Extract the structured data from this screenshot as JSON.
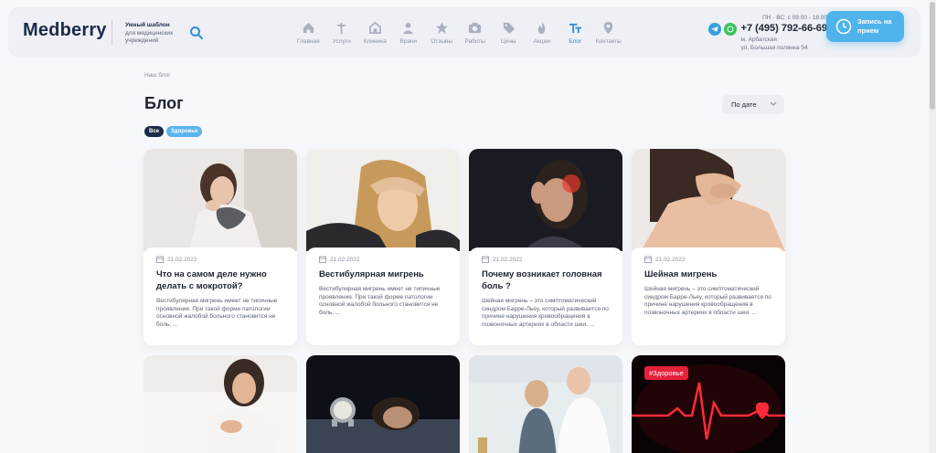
{
  "header": {
    "logo": "Medberry",
    "tagline_bold": "Умный шаблон",
    "tagline": "для медицинских учреждений",
    "nav": [
      {
        "label": "Главная",
        "icon": "home-icon"
      },
      {
        "label": "Услуги",
        "icon": "caduceus-icon"
      },
      {
        "label": "Клиника",
        "icon": "clinic-icon"
      },
      {
        "label": "Врачи",
        "icon": "doctor-icon"
      },
      {
        "label": "Отзывы",
        "icon": "star-icon"
      },
      {
        "label": "Работы",
        "icon": "camera-icon"
      },
      {
        "label": "Цены",
        "icon": "tag-icon"
      },
      {
        "label": "Акции",
        "icon": "fire-icon"
      },
      {
        "label": "Блог",
        "icon": "text-icon",
        "active": true
      },
      {
        "label": "Контакты",
        "icon": "map-pin-icon"
      }
    ],
    "hours": "ПН - ВС: с 09:00 - 18:00",
    "phone": "+7 (495) 792-66-69",
    "metro": "м. Арбатская",
    "address": "ул. Большая полянка 54",
    "cta": "Запись на прием",
    "accent": "#4fb3ec"
  },
  "breadcrumb": "Наш блог",
  "page_title": "Блог",
  "sort": {
    "selected": "По дате"
  },
  "filters": [
    "Все",
    "Здоровье"
  ],
  "cards": [
    {
      "date": "21.02.2022",
      "title": "Что на самом деле нужно делать с мокротой?",
      "excerpt": "Вестибулярная мигрень имеет не типичные проявления. При такой форме патологии основной жалобой больного становится не боль, ..."
    },
    {
      "date": "21.02.2022",
      "title": "Вестибулярная мигрень",
      "excerpt": "Вестибулярная мигрень имеет не типичные проявления. При такой форме патологии основной жалобой больного становится не боль, ..."
    },
    {
      "date": "21.02.2022",
      "title": "Почему возникает головная боль ?",
      "excerpt": "Шейная мигрень – это симптоматический синдром Барре-Льеу, который развивается по причине нарушения кровообращения в позвоночных артериях в области шеи. ..."
    },
    {
      "date": "21.02.2022",
      "title": "Шейная мигрень",
      "excerpt": "Шейная мигрень – это симптоматический синдром Барре-Льеу, который развивается по причине нарушения кровообращения в позвоночных артериях в области шеи. ..."
    }
  ],
  "second_row_tag": "#Здоровье"
}
